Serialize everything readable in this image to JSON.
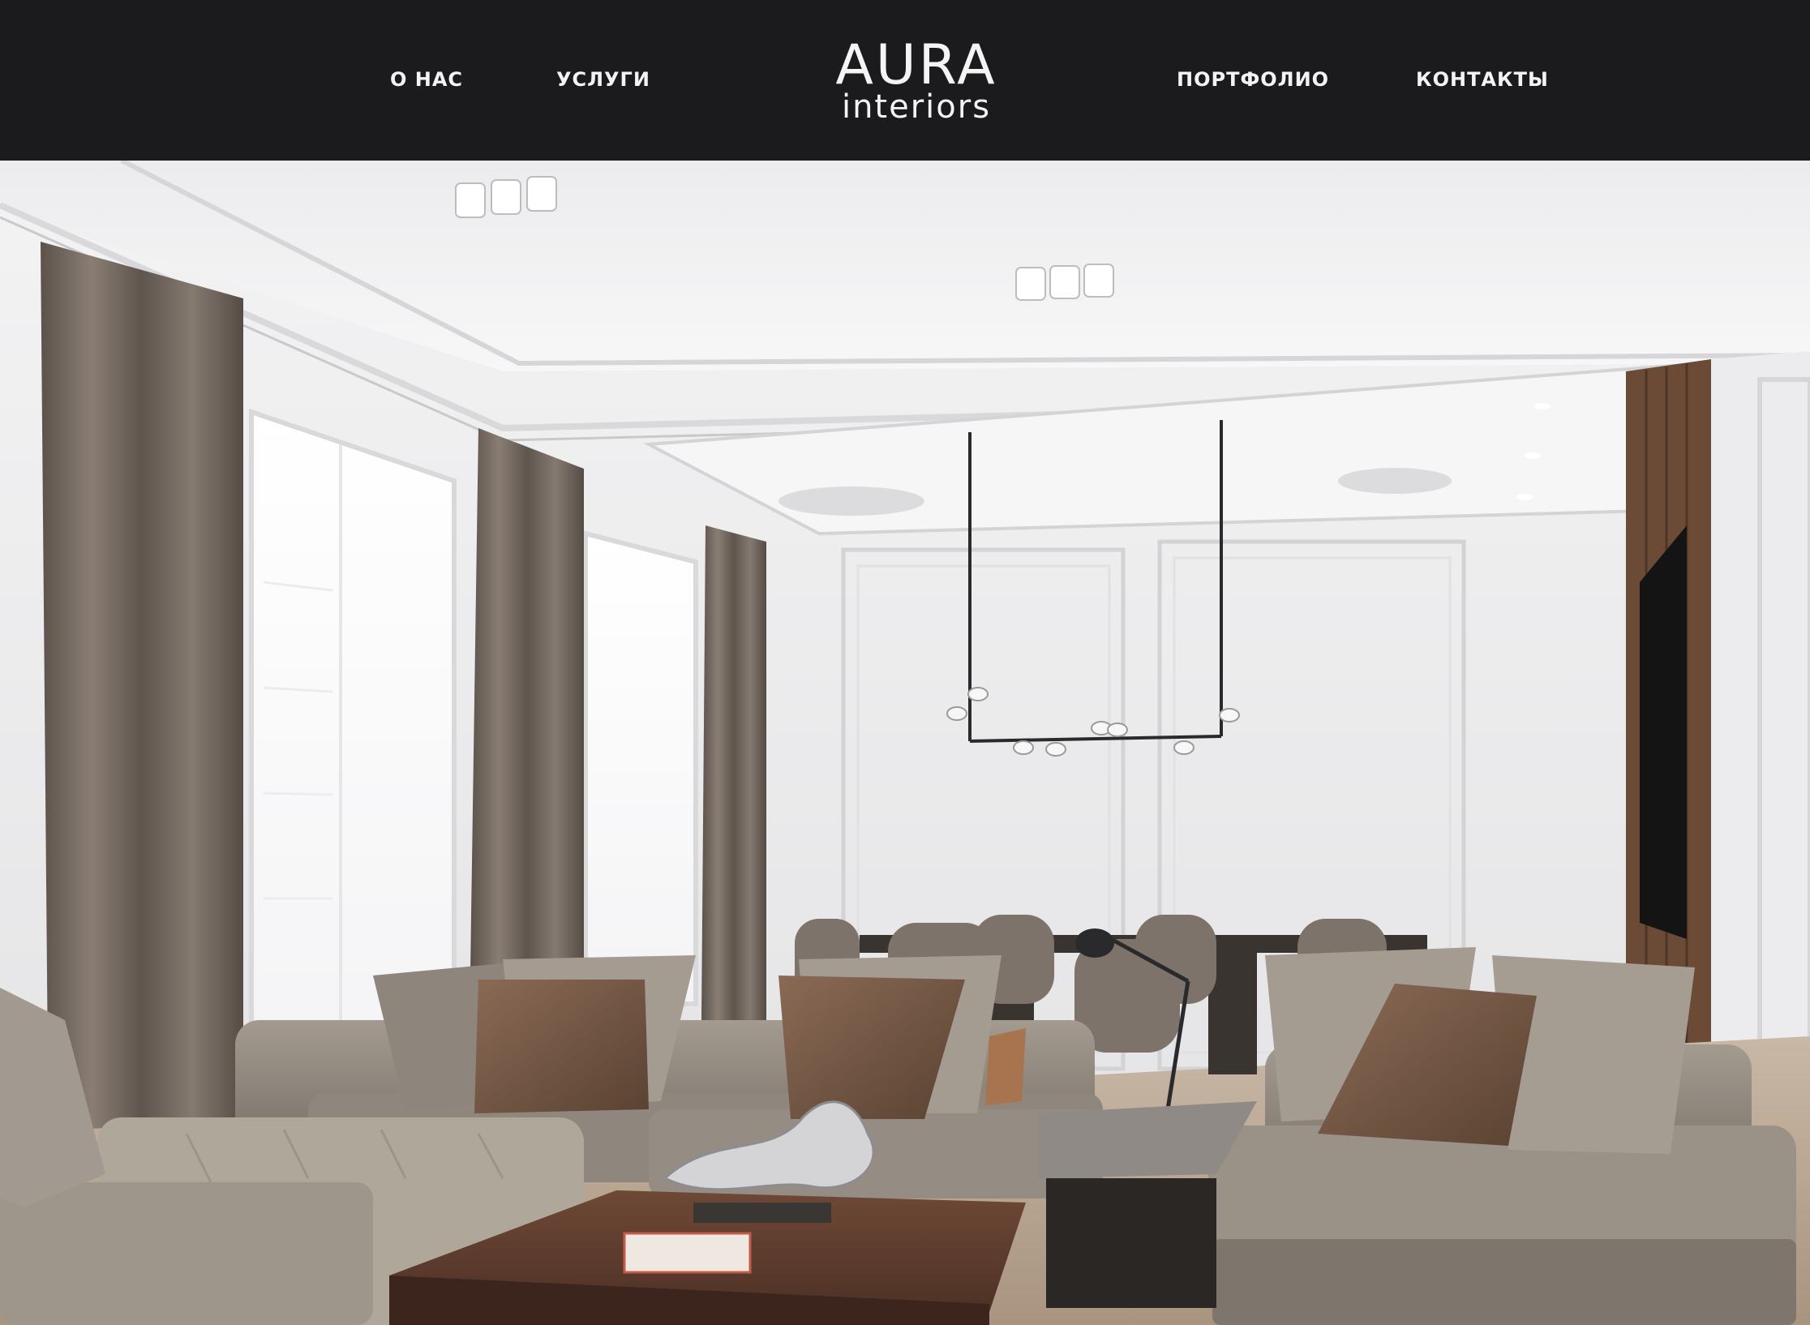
{
  "header": {
    "logo": {
      "main": "AURA",
      "sub": "interiors"
    },
    "nav": {
      "about": "О НАС",
      "services": "УСЛУГИ",
      "portfolio": "ПОРТФОЛИО",
      "contacts": "КОНТАКТЫ"
    }
  },
  "hero": {
    "image_subject": "living-room-interior-photo"
  },
  "colors": {
    "header_bg": "#1b1b1d",
    "header_text": "#f3f3f3",
    "wall": "#e8e8ea",
    "curtain": "#6f655d",
    "sofa": "#8e857c",
    "pillow_brown": "#6e5240",
    "table_wood": "#5a3a2c"
  }
}
